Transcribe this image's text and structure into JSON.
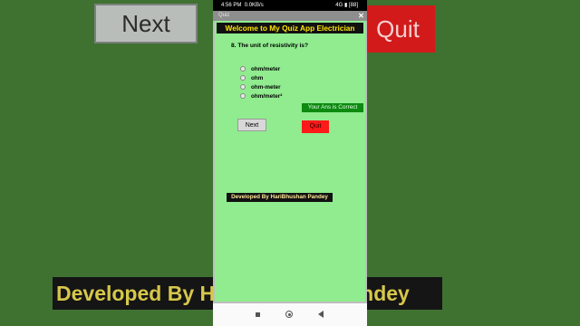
{
  "background": {
    "next_label": "Next",
    "quit_label": "Quit",
    "developer_text": "Developed By HariBhushan Pandey"
  },
  "statusbar": {
    "time": "4:56 PM",
    "speed": "0.0KB/s",
    "network": "4G",
    "battery": "88"
  },
  "window": {
    "title": "Quiz",
    "close_glyph": "✕"
  },
  "app": {
    "header": "Welcome to My Quiz App Electrician",
    "question": "8.  The unit of resistivity is?",
    "options": [
      "ohm/meter",
      "ohm",
      "ohm-meter",
      "ohm/meter²"
    ],
    "result": "Your Ans is Correct",
    "next_label": "Next",
    "quit_label": "Quit",
    "developer_text": "Developed By HariBhushan Pandey"
  },
  "colors": {
    "app_bg": "#90ec8f",
    "header_bg": "#111111",
    "header_text": "#ffe600",
    "result_bg": "#0d8a10",
    "quit_bg": "#ff1a1a",
    "page_bg": "#3f7231"
  }
}
